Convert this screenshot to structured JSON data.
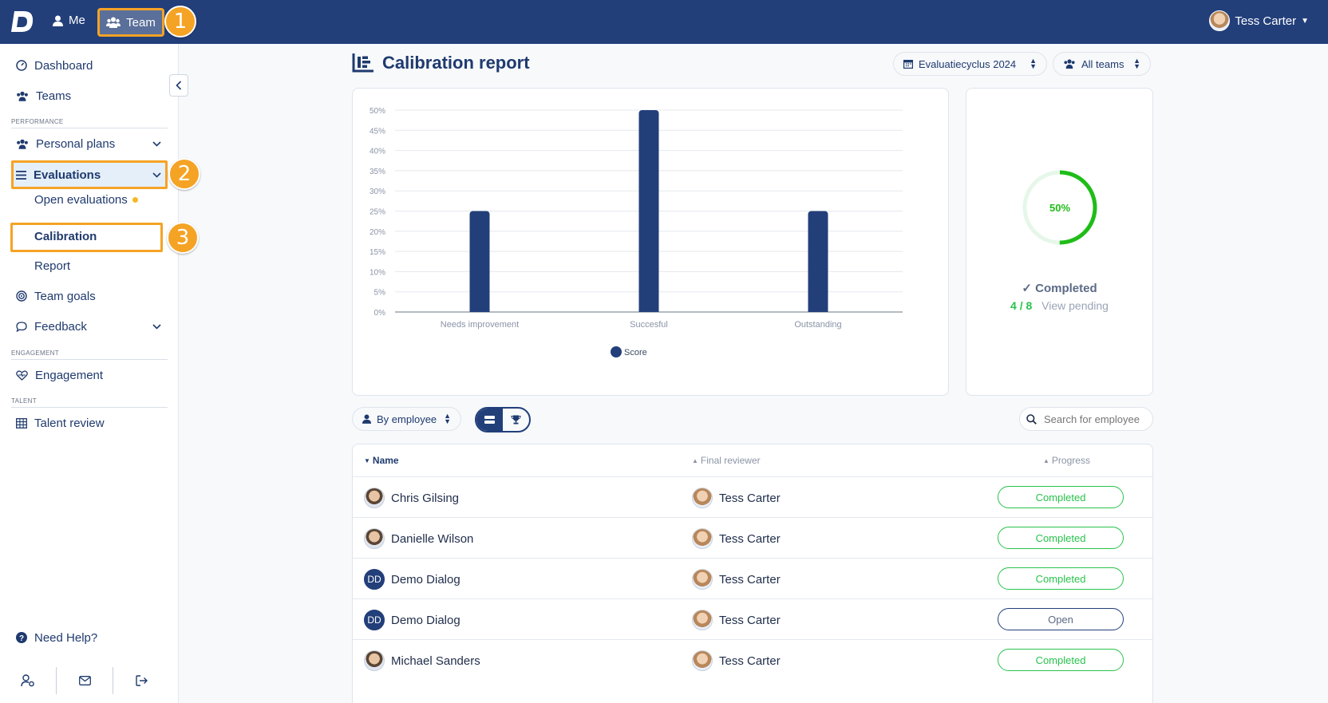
{
  "topbar": {
    "me_label": "Me",
    "team_label": "Team",
    "user_name": "Tess Carter"
  },
  "callouts": [
    "1",
    "2",
    "3"
  ],
  "sidebar": {
    "dashboard": "Dashboard",
    "teams": "Teams",
    "section_performance": "PERFORMANCE",
    "personal_plans": "Personal plans",
    "evaluations": "Evaluations",
    "open_evaluations": "Open evaluations",
    "calibration": "Calibration",
    "report": "Report",
    "team_goals": "Team goals",
    "feedback": "Feedback",
    "section_engagement": "ENGAGEMENT",
    "engagement": "Engagement",
    "section_talent": "TALENT",
    "talent_review": "Talent review",
    "need_help": "Need Help?"
  },
  "page": {
    "title": "Calibration report",
    "cycle_select": "Evaluatiecyclus 2024",
    "team_select": "All teams",
    "group_by": "By employee",
    "search_placeholder": "Search for employee"
  },
  "progress": {
    "percent": 50,
    "percent_label": "50%",
    "completed_label": "Completed",
    "count": "4 / 8",
    "view_pending": "View pending"
  },
  "chart_data": {
    "type": "bar",
    "categories": [
      "Needs improvement",
      "Succesful",
      "Outstanding"
    ],
    "series": [
      {
        "name": "Score",
        "values": [
          25,
          50,
          25
        ]
      }
    ],
    "ylim": [
      0,
      50
    ],
    "yticks": [
      "0%",
      "5%",
      "10%",
      "15%",
      "20%",
      "25%",
      "30%",
      "35%",
      "40%",
      "45%",
      "50%"
    ],
    "title": "",
    "xlabel": "",
    "ylabel": "",
    "grid": true,
    "legend": "bottom",
    "color": "#223f7a"
  },
  "table": {
    "headers": {
      "name": "Name",
      "reviewer": "Final reviewer",
      "progress": "Progress"
    },
    "rows": [
      {
        "name": "Chris Gilsing",
        "avatar": "photo",
        "initials": "",
        "reviewer": "Tess Carter",
        "status": "Completed"
      },
      {
        "name": "Danielle Wilson",
        "avatar": "photo",
        "initials": "",
        "reviewer": "Tess Carter",
        "status": "Completed"
      },
      {
        "name": "Demo Dialog",
        "avatar": "initials",
        "initials": "DD",
        "reviewer": "Tess Carter",
        "status": "Completed"
      },
      {
        "name": "Demo Dialog",
        "avatar": "initials",
        "initials": "DD",
        "reviewer": "Tess Carter",
        "status": "Open"
      },
      {
        "name": "Michael Sanders",
        "avatar": "photo",
        "initials": "",
        "reviewer": "Tess Carter",
        "status": "Completed"
      }
    ]
  },
  "colors": {
    "brand": "#223f7a",
    "accent": "#f5a325",
    "success": "#28c34b"
  }
}
